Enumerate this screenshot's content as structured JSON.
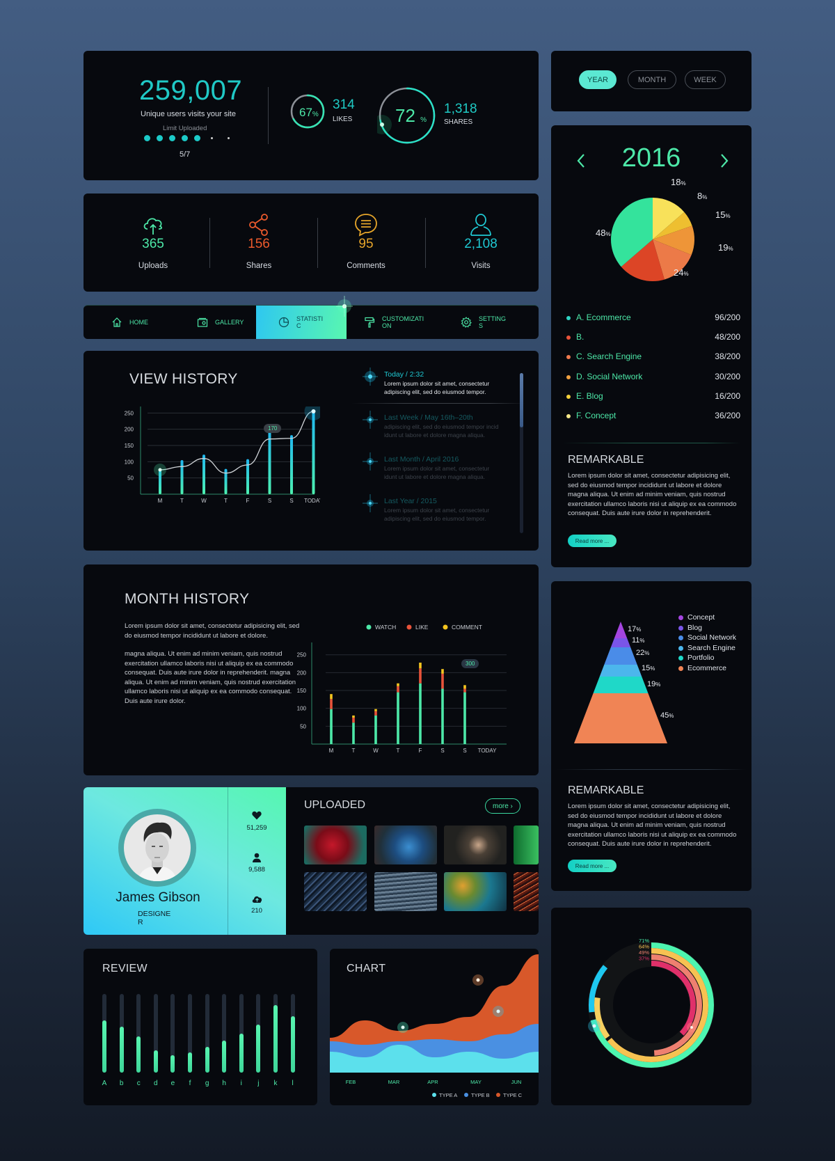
{
  "overview": {
    "unique_visits": "259,007",
    "unique_visits_label": "Unique users visits your site",
    "limit_label": "Limit Uploaded",
    "limit_value": 5,
    "limit_total": 7,
    "limit_text": "5/7",
    "likes": {
      "percent": 67,
      "percent_text": "67",
      "count": "314",
      "label": "LIKES"
    },
    "shares": {
      "percent": 72,
      "percent_text": "72",
      "count": "1,318",
      "label": "SHARES"
    },
    "percent_sign": "%"
  },
  "quick_stats": [
    {
      "icon": "cloud-upload-icon",
      "value": "365",
      "label": "Uploads",
      "color": "#4de8a8"
    },
    {
      "icon": "share-icon",
      "value": "156",
      "label": "Shares",
      "color": "#ec5a2c"
    },
    {
      "icon": "comment-icon",
      "value": "95",
      "label": "Comments",
      "color": "#e6a52a"
    },
    {
      "icon": "user-icon",
      "value": "2,108",
      "label": "Visits",
      "color": "#1fc8d2"
    }
  ],
  "nav": {
    "items": [
      {
        "label": "HOME",
        "icon": "home-icon",
        "active": false
      },
      {
        "label": "GALLERY",
        "icon": "gallery-icon",
        "active": false
      },
      {
        "label": "STATISTIC",
        "icon": "pie-chart-icon",
        "active": true
      },
      {
        "label": "CUSTOMIZATION",
        "icon": "paint-roller-icon",
        "active": false
      },
      {
        "label": "SETTINGS",
        "icon": "gear-icon",
        "active": false
      }
    ]
  },
  "view_history": {
    "title": "VIEW HISTORY",
    "tooltip": "170",
    "timeline": [
      {
        "title": "Today / 2:32",
        "text": "Lorem ipsum dolor sit amet, consectetur adipiscing elit, sed do eiusmod tempor.",
        "active": true
      },
      {
        "title": "Last Week / May 16th–20th",
        "text": "adipiscing elit, sed do eiusmod tempor incid idunt ut labore et dolore magna aliqua.",
        "active": false
      },
      {
        "title": "Last Month / April 2016",
        "text": "Lorem ipsum dolor sit amet, consectetur idunt ut labore et dolore magna aliqua.",
        "active": false
      },
      {
        "title": "Last Year / 2015",
        "text": "Lorem ipsum dolor sit amet, consectetur adipiscing elit, sed do eiusmod tempor.",
        "active": false
      }
    ]
  },
  "month_history": {
    "title": "MONTH HISTORY",
    "para1": "Lorem ipsum dolor sit amet, consectetur adipisicing elit, sed do eiusmod tempor incididunt ut labore et dolore.",
    "para2": "magna aliqua. Ut enim ad minim veniam, quis nostrud exercitation ullamco laboris nisi ut aliquip ex ea commodo consequat. Duis aute irure dolor in reprehenderit. magna aliqua. Ut enim ad minim veniam, quis nostrud exercitation ullamco laboris nisi ut aliquip ex ea commodo consequat. Duis aute irure dolor.",
    "tooltip": "300"
  },
  "profile": {
    "name": "James Gibson",
    "role": "DESIGNER",
    "stats": [
      {
        "icon": "heart-icon",
        "value": "51,259"
      },
      {
        "icon": "user-icon",
        "value": "9,588"
      },
      {
        "icon": "cloud-upload-icon",
        "value": "210"
      }
    ],
    "uploaded_title": "UPLOADED",
    "more_label": "more ›",
    "thumbnails": [
      "red-flower",
      "blue-nebula",
      "hands",
      "green-leaf",
      "dark-swirl",
      "ocean-waves",
      "gold-teal-abstract",
      "red-fibers"
    ]
  },
  "review": {
    "title": "REVIEW"
  },
  "area_chart": {
    "title": "CHART"
  },
  "period": {
    "options": [
      {
        "label": "YEAR",
        "active": true
      },
      {
        "label": "MONTH",
        "active": false
      },
      {
        "label": "WEEK",
        "active": false
      }
    ]
  },
  "year_panel": {
    "year": "2016",
    "prev_icon": "chevron-left-icon",
    "next_icon": "chevron-right-icon",
    "legend": [
      {
        "label": "A. Ecommerce",
        "value": "96/200",
        "color": "#2fd6c4"
      },
      {
        "label": "B.",
        "value": "48/200",
        "color": "#e8533a"
      },
      {
        "label": "C. Search Engine",
        "value": "38/200",
        "color": "#ef7a4e"
      },
      {
        "label": "D. Social Network",
        "value": "30/200",
        "color": "#f0a040"
      },
      {
        "label": "E. Blog",
        "value": "16/200",
        "color": "#f4d03a"
      },
      {
        "label": "F. Concept",
        "value": "36/200",
        "color": "#f6e88a"
      }
    ],
    "remark_title": "REMARKABLE",
    "remark_text": "Lorem ipsum dolor sit amet, consectetur adipisicing elit, sed do eiusmod tempor incididunt ut labore et dolore magna aliqua. Ut enim ad minim veniam, quis nostrud exercitation ullamco laboris nisi ut aliquip ex ea commodo consequat. Duis aute irure dolor in reprehenderit.",
    "read_more": "Read more ..."
  },
  "pyramid_panel": {
    "remark_title": "REMARKABLE",
    "remark_text": "Lorem ipsum dolor sit amet, consectetur adipisicing elit, sed do eiusmod tempor incididunt ut labore et dolore magna aliqua. Ut enim ad minim veniam, quis nostrud exercitation ullamco laboris nisi ut aliquip ex ea commodo consequat. Duis aute irure dolor in reprehenderit.",
    "read_more": "Read more ..."
  },
  "chart_data": [
    {
      "id": "view_history",
      "type": "bar",
      "title": "VIEW HISTORY",
      "categories": [
        "M",
        "T",
        "W",
        "T",
        "F",
        "S",
        "S",
        "TODAY"
      ],
      "values": [
        80,
        105,
        122,
        78,
        108,
        202,
        182,
        255
      ],
      "line_values": [
        75,
        85,
        110,
        65,
        90,
        170,
        172,
        255
      ],
      "yticks": [
        50,
        100,
        150,
        200,
        250
      ],
      "ylim": [
        0,
        270
      ],
      "annotation": "170"
    },
    {
      "id": "month_history",
      "type": "bar",
      "stacked": true,
      "title": "MONTH HISTORY",
      "categories": [
        "M",
        "T",
        "W",
        "T",
        "F",
        "S",
        "S",
        "TODAY"
      ],
      "series": [
        {
          "name": "WATCH",
          "color": "#4de8a8",
          "values": [
            98,
            60,
            80,
            145,
            170,
            155,
            145,
            0
          ]
        },
        {
          "name": "LIKE",
          "color": "#e8533a",
          "values": [
            28,
            14,
            12,
            17,
            42,
            42,
            10,
            0
          ]
        },
        {
          "name": "COMMENT",
          "color": "#f4c51f",
          "values": [
            14,
            6,
            6,
            8,
            16,
            13,
            10,
            0
          ]
        }
      ],
      "yticks": [
        50,
        100,
        150,
        200,
        250
      ],
      "ylim": [
        0,
        265
      ],
      "legend": "top-right",
      "annotation": "300"
    },
    {
      "id": "year_pie",
      "type": "pie",
      "title": "2016",
      "slices": [
        {
          "label": "18%",
          "value": 18,
          "color": "#f8e15a"
        },
        {
          "label": "8%",
          "value": 8,
          "color": "#eebf30"
        },
        {
          "label": "15%",
          "value": 15,
          "color": "#ee9538"
        },
        {
          "label": "19%",
          "value": 19,
          "color": "#ec7a48"
        },
        {
          "label": "24%",
          "value": 24,
          "color": "#dc4526"
        },
        {
          "label": "48%",
          "value": 48,
          "color": "#34e39c"
        }
      ]
    },
    {
      "id": "pyramid",
      "type": "bar",
      "subtype": "pyramid",
      "levels": [
        {
          "label": "Concept",
          "value": 17,
          "color": "#a445e0"
        },
        {
          "label": "Blog",
          "value": 11,
          "color": "#7a55e8"
        },
        {
          "label": "Social Network",
          "value": 22,
          "color": "#4a8ce8"
        },
        {
          "label": "Search Engine",
          "value": 15,
          "color": "#4cb6ec"
        },
        {
          "label": "Portfolio",
          "value": 19,
          "color": "#1fd8c8"
        },
        {
          "label": "Ecommerce",
          "value": 45,
          "color": "#f08455"
        }
      ]
    },
    {
      "id": "review",
      "type": "bar",
      "title": "REVIEW",
      "categories": [
        "A",
        "b",
        "c",
        "d",
        "e",
        "f",
        "g",
        "h",
        "i",
        "j",
        "k",
        "l"
      ],
      "values": [
        0.66,
        0.58,
        0.46,
        0.28,
        0.22,
        0.26,
        0.33,
        0.41,
        0.5,
        0.61,
        0.86,
        0.72
      ],
      "ylim": [
        0,
        1
      ]
    },
    {
      "id": "area_chart",
      "type": "area",
      "title": "CHART",
      "categories": [
        "FEB",
        "MAR",
        "APR",
        "MAY",
        "JUN"
      ],
      "series": [
        {
          "name": "TYPE A",
          "color": "#5ce0ec",
          "values": [
            30,
            22,
            40,
            22,
            30,
            20,
            30
          ]
        },
        {
          "name": "TYPE B",
          "color": "#4a90e2",
          "values": [
            45,
            40,
            45,
            48,
            45,
            55,
            70
          ]
        },
        {
          "name": "TYPE C",
          "color": "#d8582a",
          "values": [
            50,
            75,
            60,
            70,
            80,
            125,
            170
          ]
        }
      ],
      "legend": "bottom"
    },
    {
      "id": "radial",
      "type": "pie",
      "subtype": "radial-bar",
      "series": [
        {
          "label": "71%",
          "value": 71,
          "color": "#4df5b0"
        },
        {
          "label": "64%",
          "value": 64,
          "color": "#f7c252"
        },
        {
          "label": "49%",
          "value": 49,
          "color": "#ee8070"
        },
        {
          "label": "37%",
          "value": 37,
          "color": "#e0306a"
        }
      ]
    }
  ]
}
